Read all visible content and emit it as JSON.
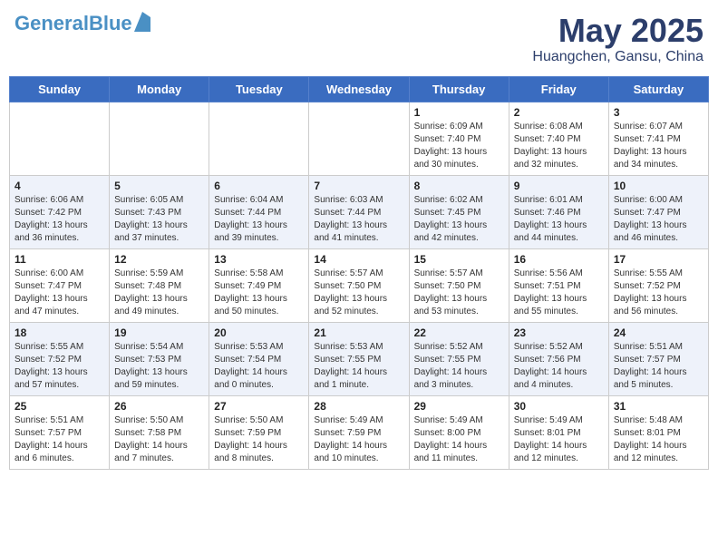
{
  "header": {
    "logo_line1": "General",
    "logo_line2": "Blue",
    "month": "May 2025",
    "location": "Huangchen, Gansu, China"
  },
  "days_of_week": [
    "Sunday",
    "Monday",
    "Tuesday",
    "Wednesday",
    "Thursday",
    "Friday",
    "Saturday"
  ],
  "weeks": [
    [
      {
        "day": "",
        "info": ""
      },
      {
        "day": "",
        "info": ""
      },
      {
        "day": "",
        "info": ""
      },
      {
        "day": "",
        "info": ""
      },
      {
        "day": "1",
        "info": "Sunrise: 6:09 AM\nSunset: 7:40 PM\nDaylight: 13 hours\nand 30 minutes."
      },
      {
        "day": "2",
        "info": "Sunrise: 6:08 AM\nSunset: 7:40 PM\nDaylight: 13 hours\nand 32 minutes."
      },
      {
        "day": "3",
        "info": "Sunrise: 6:07 AM\nSunset: 7:41 PM\nDaylight: 13 hours\nand 34 minutes."
      }
    ],
    [
      {
        "day": "4",
        "info": "Sunrise: 6:06 AM\nSunset: 7:42 PM\nDaylight: 13 hours\nand 36 minutes."
      },
      {
        "day": "5",
        "info": "Sunrise: 6:05 AM\nSunset: 7:43 PM\nDaylight: 13 hours\nand 37 minutes."
      },
      {
        "day": "6",
        "info": "Sunrise: 6:04 AM\nSunset: 7:44 PM\nDaylight: 13 hours\nand 39 minutes."
      },
      {
        "day": "7",
        "info": "Sunrise: 6:03 AM\nSunset: 7:44 PM\nDaylight: 13 hours\nand 41 minutes."
      },
      {
        "day": "8",
        "info": "Sunrise: 6:02 AM\nSunset: 7:45 PM\nDaylight: 13 hours\nand 42 minutes."
      },
      {
        "day": "9",
        "info": "Sunrise: 6:01 AM\nSunset: 7:46 PM\nDaylight: 13 hours\nand 44 minutes."
      },
      {
        "day": "10",
        "info": "Sunrise: 6:00 AM\nSunset: 7:47 PM\nDaylight: 13 hours\nand 46 minutes."
      }
    ],
    [
      {
        "day": "11",
        "info": "Sunrise: 6:00 AM\nSunset: 7:47 PM\nDaylight: 13 hours\nand 47 minutes."
      },
      {
        "day": "12",
        "info": "Sunrise: 5:59 AM\nSunset: 7:48 PM\nDaylight: 13 hours\nand 49 minutes."
      },
      {
        "day": "13",
        "info": "Sunrise: 5:58 AM\nSunset: 7:49 PM\nDaylight: 13 hours\nand 50 minutes."
      },
      {
        "day": "14",
        "info": "Sunrise: 5:57 AM\nSunset: 7:50 PM\nDaylight: 13 hours\nand 52 minutes."
      },
      {
        "day": "15",
        "info": "Sunrise: 5:57 AM\nSunset: 7:50 PM\nDaylight: 13 hours\nand 53 minutes."
      },
      {
        "day": "16",
        "info": "Sunrise: 5:56 AM\nSunset: 7:51 PM\nDaylight: 13 hours\nand 55 minutes."
      },
      {
        "day": "17",
        "info": "Sunrise: 5:55 AM\nSunset: 7:52 PM\nDaylight: 13 hours\nand 56 minutes."
      }
    ],
    [
      {
        "day": "18",
        "info": "Sunrise: 5:55 AM\nSunset: 7:52 PM\nDaylight: 13 hours\nand 57 minutes."
      },
      {
        "day": "19",
        "info": "Sunrise: 5:54 AM\nSunset: 7:53 PM\nDaylight: 13 hours\nand 59 minutes."
      },
      {
        "day": "20",
        "info": "Sunrise: 5:53 AM\nSunset: 7:54 PM\nDaylight: 14 hours\nand 0 minutes."
      },
      {
        "day": "21",
        "info": "Sunrise: 5:53 AM\nSunset: 7:55 PM\nDaylight: 14 hours\nand 1 minute."
      },
      {
        "day": "22",
        "info": "Sunrise: 5:52 AM\nSunset: 7:55 PM\nDaylight: 14 hours\nand 3 minutes."
      },
      {
        "day": "23",
        "info": "Sunrise: 5:52 AM\nSunset: 7:56 PM\nDaylight: 14 hours\nand 4 minutes."
      },
      {
        "day": "24",
        "info": "Sunrise: 5:51 AM\nSunset: 7:57 PM\nDaylight: 14 hours\nand 5 minutes."
      }
    ],
    [
      {
        "day": "25",
        "info": "Sunrise: 5:51 AM\nSunset: 7:57 PM\nDaylight: 14 hours\nand 6 minutes."
      },
      {
        "day": "26",
        "info": "Sunrise: 5:50 AM\nSunset: 7:58 PM\nDaylight: 14 hours\nand 7 minutes."
      },
      {
        "day": "27",
        "info": "Sunrise: 5:50 AM\nSunset: 7:59 PM\nDaylight: 14 hours\nand 8 minutes."
      },
      {
        "day": "28",
        "info": "Sunrise: 5:49 AM\nSunset: 7:59 PM\nDaylight: 14 hours\nand 10 minutes."
      },
      {
        "day": "29",
        "info": "Sunrise: 5:49 AM\nSunset: 8:00 PM\nDaylight: 14 hours\nand 11 minutes."
      },
      {
        "day": "30",
        "info": "Sunrise: 5:49 AM\nSunset: 8:01 PM\nDaylight: 14 hours\nand 12 minutes."
      },
      {
        "day": "31",
        "info": "Sunrise: 5:48 AM\nSunset: 8:01 PM\nDaylight: 14 hours\nand 12 minutes."
      }
    ]
  ]
}
